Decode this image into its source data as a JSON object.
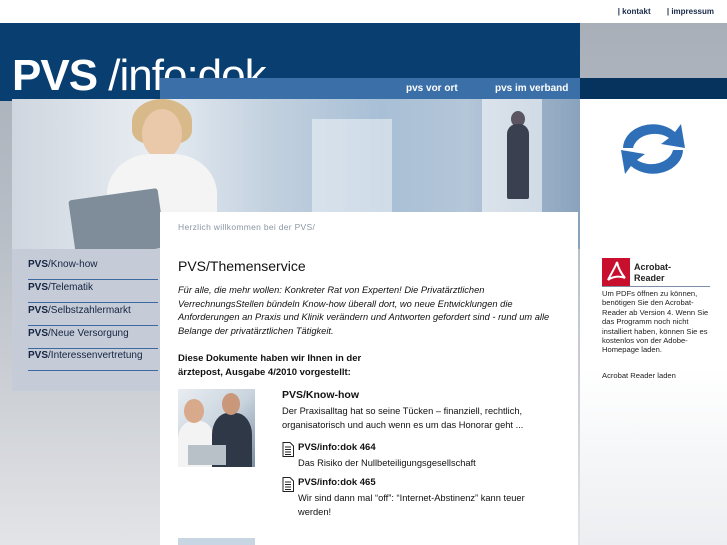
{
  "top_links": [
    "kontakt",
    "impressum"
  ],
  "logo": {
    "bold": "PVS",
    "rest": " /info:dok"
  },
  "nav": [
    "pvs vor ort",
    "pvs im verband"
  ],
  "welcome": "Herzlich willkommen bei der PVS/",
  "sidenav": [
    {
      "bold": "PVS",
      "rest": "/Know-how"
    },
    {
      "bold": "PVS",
      "rest": "/Telematik"
    },
    {
      "bold": "PVS",
      "rest": "/Selbstzahlermarkt"
    },
    {
      "bold": "PVS",
      "rest": "/Neue Versorgung"
    },
    {
      "bold": "PVS",
      "rest": "/Interessenvertretung"
    }
  ],
  "main": {
    "title": "PVS/Themenservice",
    "intro": "Für alle, die mehr wollen: Konkreter Rat von Experten! Die Privatärztlichen VerrechnungsStellen bündeln Know-how überall dort, wo neue Entwicklungen die Anforderungen an Praxis und Klinik verändern und Antworten gefordert sind - rund um alle Belange der privatärztlichen Tätigkeit.",
    "docs_head": "Diese Dokumente haben wir Ihnen in der ärztepost, Ausgabe 4/2010 vorgestellt:",
    "knowhow": {
      "title": "PVS/Know-how",
      "text": "Der Praxisalltag hat so seine Tücken – finanziell, rechtlich, organisatorisch und auch wenn es um das Honorar geht ..."
    },
    "docs": [
      {
        "title": "PVS/info:dok 464",
        "desc": "Das Risiko der Nullbeteiligungsgesellschaft"
      },
      {
        "title": "PVS/info:dok 465",
        "desc": "Wir sind dann mal “off”: “Internet-Abstinenz” kann teuer werden!"
      }
    ]
  },
  "acrobat": {
    "name": "Acrobat-Reader",
    "text": "Um PDFs öffnen zu können, benötigen Sie den Acrobat-Reader ab Version 4. Wenn Sie das Programm noch nicht installiert haben, können Sie es kostenlos von der Adobe-Homepage laden.",
    "download": "Acrobat Reader laden"
  },
  "colors": {
    "header": "#083e70",
    "nav": "#3a6fa8",
    "sidenav": "#c5ccd8",
    "accent": "#2f6fb8"
  }
}
